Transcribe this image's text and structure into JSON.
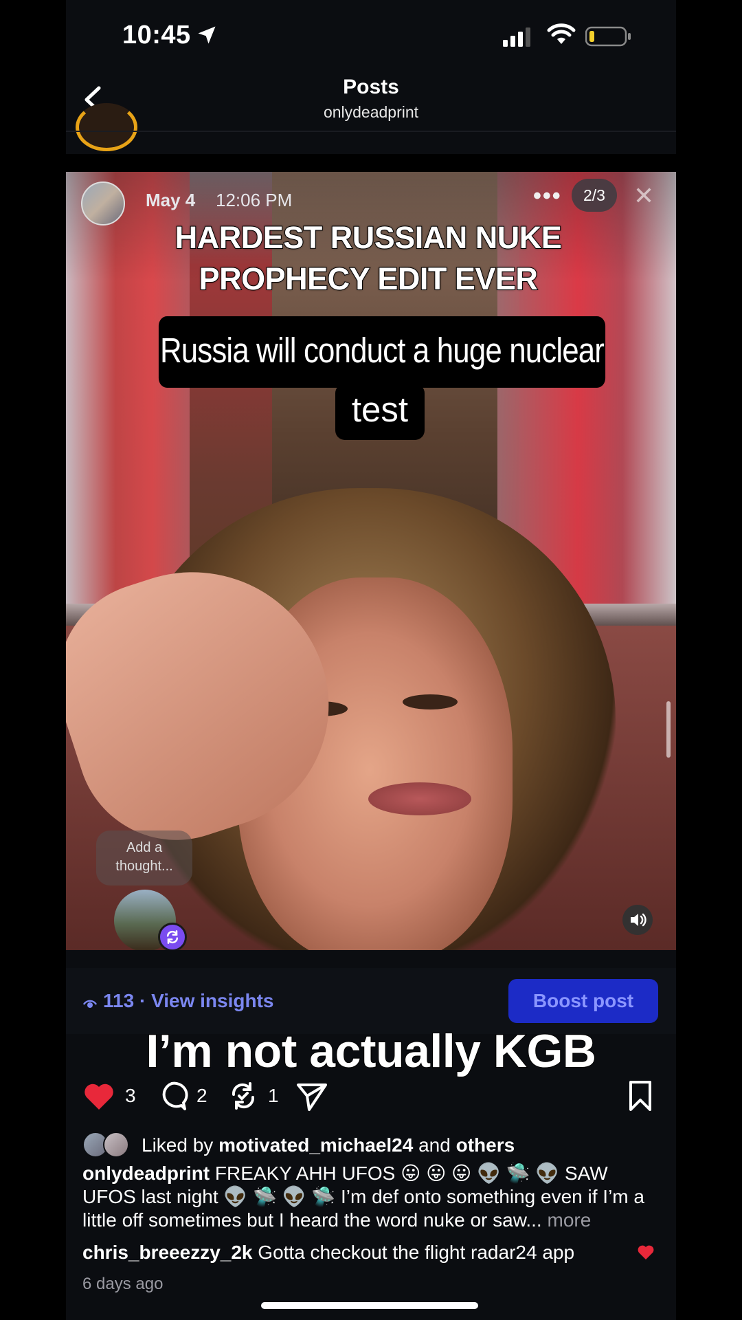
{
  "status_bar": {
    "time": "10:45"
  },
  "nav": {
    "title": "Posts",
    "subtitle": "onlydeadprint"
  },
  "post": {
    "date": "May 4",
    "time": "12:06 PM",
    "more": "•••",
    "counter": "2/3",
    "headline_line1": "HARDEST RUSSIAN NUKE",
    "headline_line2": "PROPHECY EDIT EVER",
    "caption_line1": "Russia will conduct a huge nuclear",
    "caption_line2": "test",
    "add_thought": "Add a thought..."
  },
  "insights": {
    "views": "113",
    "separator": "·",
    "link": "View insights",
    "boost": "Boost post"
  },
  "overlay_caption": "I’m not actually KGB",
  "actions": {
    "likes": "3",
    "comments": "2",
    "reposts": "1"
  },
  "liked_by": {
    "prefix": "Liked by",
    "user": "motivated_michael24",
    "and": "and",
    "others": "others"
  },
  "caption": {
    "user": "onlydeadprint",
    "text": "FREAKY AHH UFOS 😛 😛 😛 👽 🛸 👽 SAW UFOS last night 👽 🛸 👽 🛸 I’m def onto something even if I’m a little off sometimes but I heard the word nuke or saw...",
    "more": "more"
  },
  "comment": {
    "user": "chris_breeezzy_2k",
    "text": "Gotta checkout the flight radar24 app"
  },
  "timestamp": "6 days ago",
  "colors": {
    "accent": "#7b87f0",
    "boost_bg": "#1c2bc6",
    "like_red": "#e8283a",
    "repost_badge": "#7a4cf0"
  }
}
